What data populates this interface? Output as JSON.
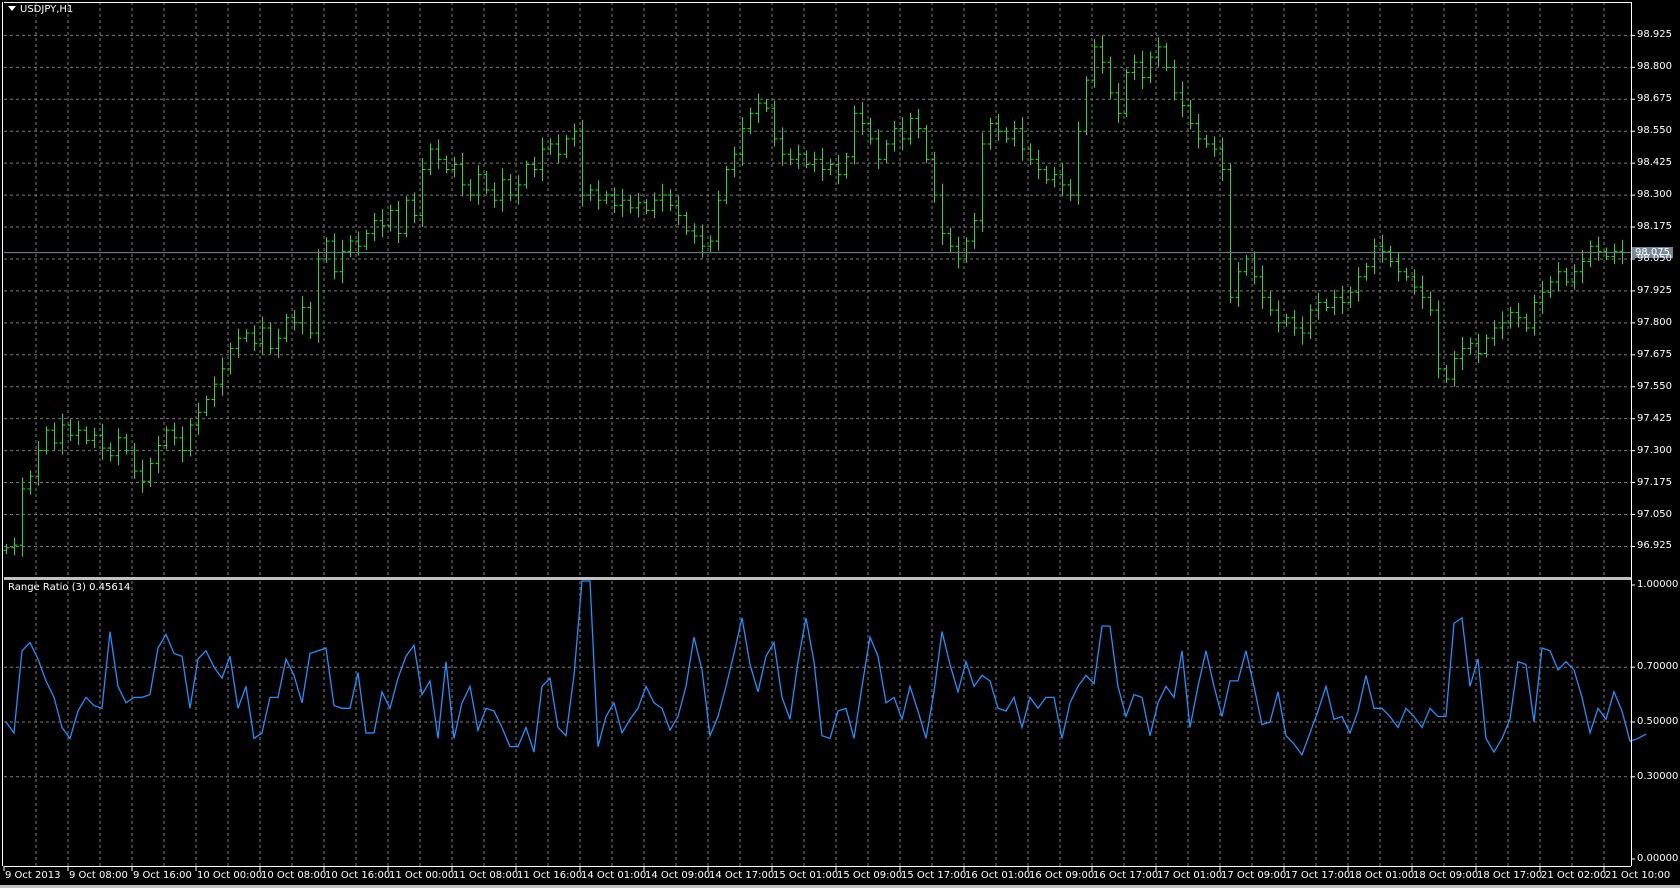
{
  "chart_title": "USDJPY,H1",
  "indicator": {
    "title": "Range Ratio (3) 0.45614"
  },
  "current_price": "98.075",
  "colors": {
    "background": "#000000",
    "bars": "#22dd22",
    "indicator": "#1e90ff",
    "grid": "#7a7a7a",
    "price_line": "#778899",
    "text": "#ffffff"
  },
  "price_axis": {
    "labels": [
      "98.925",
      "98.800",
      "98.675",
      "98.550",
      "98.425",
      "98.300",
      "98.175",
      "98.050",
      "97.925",
      "97.800",
      "97.675",
      "97.550",
      "97.425",
      "97.300",
      "97.175",
      "97.050",
      "96.925"
    ]
  },
  "indicator_axis": {
    "labels": [
      "1.00000",
      "0.70000",
      "0.50000",
      "0.30000",
      "0.00000"
    ]
  },
  "time_axis": {
    "labels": [
      "9 Oct 2013",
      "9 Oct 08:00",
      "9 Oct 16:00",
      "10 Oct 00:00",
      "10 Oct 08:00",
      "10 Oct 16:00",
      "11 Oct 00:00",
      "11 Oct 08:00",
      "11 Oct 16:00",
      "14 Oct 01:00",
      "14 Oct 09:00",
      "14 Oct 17:00",
      "15 Oct 01:00",
      "15 Oct 09:00",
      "15 Oct 17:00",
      "16 Oct 01:00",
      "16 Oct 09:00",
      "16 Oct 17:00",
      "17 Oct 01:00",
      "17 Oct 09:00",
      "17 Oct 17:00",
      "18 Oct 01:00",
      "18 Oct 09:00",
      "18 Oct 17:00",
      "21 Oct 02:00",
      "21 Oct 10:00"
    ]
  },
  "chart_data": {
    "type": "ohlc",
    "ylim": [
      96.875,
      98.99
    ],
    "indicator_ylim": [
      0,
      1
    ],
    "closes": [
      96.92,
      96.93,
      97.15,
      97.2,
      97.3,
      97.38,
      97.33,
      97.4,
      97.36,
      97.38,
      97.34,
      97.36,
      97.31,
      97.28,
      97.35,
      97.3,
      97.22,
      97.18,
      97.25,
      97.32,
      97.38,
      97.35,
      97.3,
      97.4,
      97.45,
      97.5,
      97.56,
      97.62,
      97.7,
      97.74,
      97.76,
      97.72,
      97.78,
      97.7,
      97.74,
      97.82,
      97.8,
      97.86,
      97.76,
      98.05,
      98.12,
      98.0,
      98.08,
      98.12,
      98.1,
      98.15,
      98.2,
      98.18,
      98.24,
      98.15,
      98.28,
      98.22,
      98.4,
      98.48,
      98.44,
      98.4,
      98.42,
      98.34,
      98.3,
      98.38,
      98.32,
      98.28,
      98.36,
      98.3,
      98.34,
      98.42,
      98.4,
      98.48,
      98.5,
      98.46,
      98.52,
      98.55,
      98.3,
      98.32,
      98.28,
      98.3,
      98.26,
      98.28,
      98.25,
      98.27,
      98.24,
      98.28,
      98.3,
      98.26,
      98.22,
      98.16,
      98.14,
      98.1,
      98.12,
      98.28,
      98.4,
      98.46,
      98.56,
      98.62,
      98.66,
      98.64,
      98.52,
      98.46,
      98.44,
      98.46,
      98.42,
      98.44,
      98.4,
      98.42,
      98.38,
      98.45,
      98.62,
      98.58,
      98.52,
      98.44,
      98.5,
      98.56,
      98.52,
      98.6,
      98.56,
      98.44,
      98.3,
      98.15,
      98.1,
      98.05,
      98.12,
      98.2,
      98.5,
      98.58,
      98.55,
      98.52,
      98.56,
      98.48,
      98.44,
      98.4,
      98.36,
      98.38,
      98.34,
      98.3,
      98.55,
      98.75,
      98.88,
      98.82,
      98.7,
      98.62,
      98.78,
      98.82,
      98.76,
      98.84,
      98.88,
      98.8,
      98.7,
      98.65,
      98.58,
      98.52,
      98.5,
      98.48,
      98.4,
      97.9,
      98.0,
      98.05,
      97.98,
      97.9,
      97.85,
      97.8,
      97.82,
      97.78,
      97.76,
      97.85,
      97.88,
      97.86,
      97.9,
      97.88,
      97.92,
      97.98,
      98.02,
      98.1,
      98.08,
      98.04,
      98.0,
      97.98,
      97.94,
      97.9,
      97.85,
      97.62,
      97.58,
      97.66,
      97.7,
      97.72,
      97.68,
      97.74,
      97.78,
      97.8,
      97.84,
      97.82,
      97.78,
      97.88,
      97.92,
      97.96,
      98.0,
      97.96,
      98.0,
      98.04,
      98.1,
      98.08,
      98.06,
      98.08,
      98.075
    ],
    "indicator_values": [
      0.5,
      0.46,
      0.76,
      0.79,
      0.73,
      0.65,
      0.59,
      0.48,
      0.44,
      0.54,
      0.59,
      0.56,
      0.55,
      0.83,
      0.63,
      0.57,
      0.59,
      0.59,
      0.6,
      0.77,
      0.82,
      0.75,
      0.74,
      0.55,
      0.73,
      0.76,
      0.7,
      0.66,
      0.74,
      0.55,
      0.63,
      0.44,
      0.46,
      0.59,
      0.59,
      0.73,
      0.67,
      0.57,
      0.75,
      0.76,
      0.77,
      0.56,
      0.55,
      0.55,
      0.68,
      0.46,
      0.46,
      0.61,
      0.55,
      0.66,
      0.74,
      0.78,
      0.6,
      0.65,
      0.44,
      0.72,
      0.44,
      0.57,
      0.63,
      0.47,
      0.55,
      0.54,
      0.48,
      0.41,
      0.41,
      0.48,
      0.39,
      0.63,
      0.66,
      0.48,
      0.45,
      0.67,
      1.05,
      1.08,
      0.41,
      0.52,
      0.57,
      0.46,
      0.51,
      0.55,
      0.63,
      0.57,
      0.55,
      0.47,
      0.52,
      0.63,
      0.81,
      0.69,
      0.45,
      0.52,
      0.63,
      0.75,
      0.88,
      0.71,
      0.61,
      0.74,
      0.79,
      0.59,
      0.51,
      0.72,
      0.88,
      0.72,
      0.45,
      0.44,
      0.54,
      0.55,
      0.44,
      0.63,
      0.81,
      0.74,
      0.57,
      0.59,
      0.51,
      0.63,
      0.54,
      0.44,
      0.61,
      0.83,
      0.71,
      0.61,
      0.72,
      0.63,
      0.67,
      0.65,
      0.55,
      0.54,
      0.59,
      0.48,
      0.59,
      0.55,
      0.59,
      0.59,
      0.44,
      0.57,
      0.63,
      0.67,
      0.64,
      0.85,
      0.85,
      0.63,
      0.52,
      0.6,
      0.59,
      0.45,
      0.57,
      0.63,
      0.59,
      0.76,
      0.48,
      0.63,
      0.76,
      0.63,
      0.52,
      0.65,
      0.65,
      0.76,
      0.63,
      0.49,
      0.5,
      0.61,
      0.45,
      0.42,
      0.38,
      0.46,
      0.54,
      0.63,
      0.51,
      0.52,
      0.46,
      0.54,
      0.67,
      0.55,
      0.55,
      0.52,
      0.48,
      0.55,
      0.52,
      0.48,
      0.55,
      0.52,
      0.52,
      0.86,
      0.88,
      0.63,
      0.73,
      0.44,
      0.39,
      0.44,
      0.51,
      0.72,
      0.71,
      0.5,
      0.77,
      0.76,
      0.69,
      0.72,
      0.69,
      0.59,
      0.46,
      0.55,
      0.51,
      0.61,
      0.54,
      0.43,
      0.44,
      0.45614
    ]
  }
}
